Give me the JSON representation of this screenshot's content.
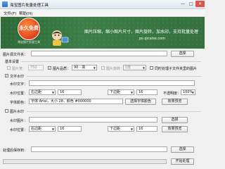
{
  "window": {
    "title": "海宝图片批量处理工具",
    "min_label": "—",
    "max_label": "□",
    "close_label": "✕"
  },
  "menu": {
    "items": [
      "文件(F)",
      "帮助(H)"
    ]
  },
  "banner": {
    "badge_text": "永久免费",
    "badge_sub": "海宝图片处理工具",
    "description": "图片压缩，缩小图片尺寸，图片旋转，加水印，支持批量处理",
    "site": "ps.qicaise.com"
  },
  "source": {
    "label": "图片源文件夹：",
    "value": "",
    "browse": "选择"
  },
  "basic": {
    "title": "基本设置",
    "width_label": "图片宽：",
    "width_value": "750",
    "quality_label": "图片品质：",
    "quality_value": "90 - 高",
    "rotate_label": "图片旋转：",
    "rotate_value": "0度",
    "sync_label": "同时处理子文件夹里的图片",
    "width_checked": false,
    "quality_checked": true,
    "rotate_checked": false,
    "sync_checked": false
  },
  "text_wm": {
    "enable_label": "文字水印",
    "enabled": true,
    "text_label": "水印文字：",
    "text_value": "",
    "pos_label": "水印位置：",
    "hpos": "右边距",
    "hval": "16",
    "vpos": "下边距",
    "vval": "16",
    "opacity_label": "不透明度：",
    "opacity_value": "100%",
    "font_label": "字体颜色：",
    "font_desc": "字体 Arial，大小 28，颜色 #000000",
    "font_btn": "选择字体颜色",
    "preview_btn": "效果预览"
  },
  "image_wm": {
    "enable_label": "图片水印",
    "enabled": false,
    "file_label": "水印图片：",
    "file_value": "",
    "browse": "选择",
    "pos_label": "水印位置：",
    "hpos": "右边距",
    "hval": "16",
    "vpos": "下边距",
    "vval": "16",
    "preview_btn": "效果预览"
  },
  "output": {
    "label": "处理后保存到：",
    "value": "",
    "browse": "选择",
    "start": "开始处理"
  },
  "progress": {
    "value": 0
  },
  "colors": {
    "banner_bg": "#3c7e47",
    "badge": "#e0431b",
    "close": "#d9534f"
  }
}
